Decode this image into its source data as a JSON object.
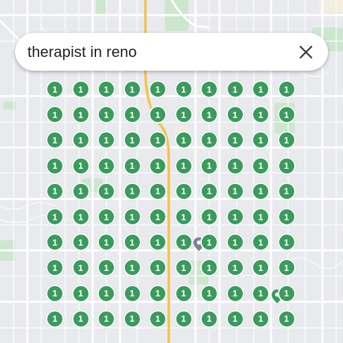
{
  "search": {
    "query": "therapist in reno",
    "close_icon": "close-icon"
  },
  "clusters": {
    "rows": 10,
    "cols": 10,
    "label": "1",
    "color": "#3a9b5c"
  },
  "map": {
    "highway_color": "#f7c95e",
    "park_color": "#c8e6c9",
    "road_color": "#ffffff",
    "background_color": "#e8eaed"
  }
}
